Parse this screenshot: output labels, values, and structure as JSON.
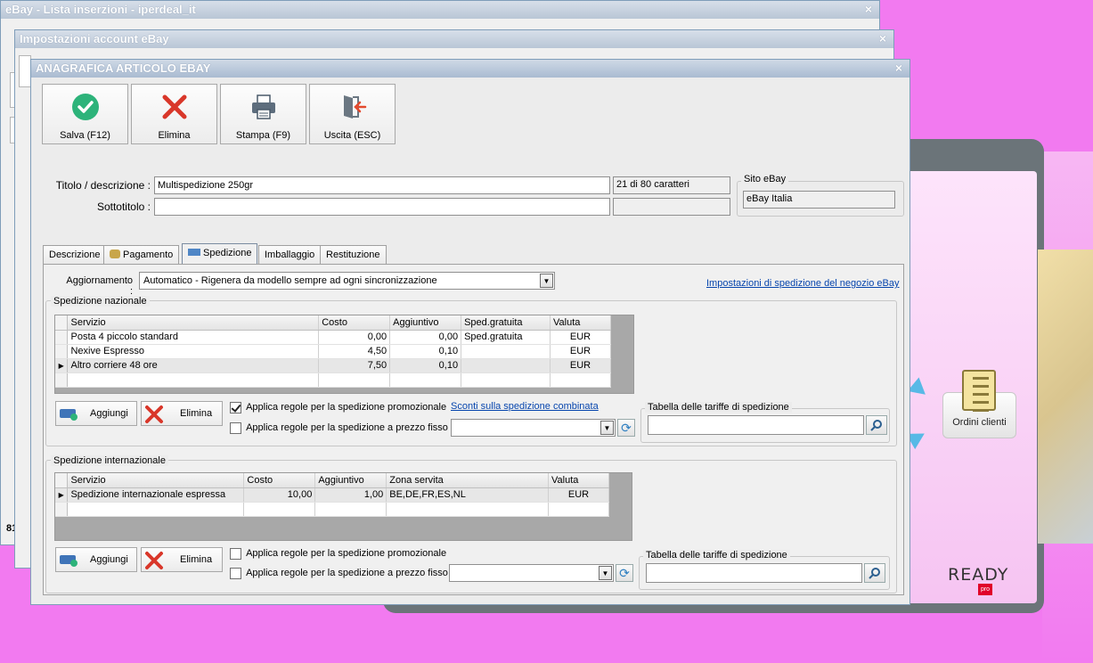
{
  "background": {
    "ordini_label": "Ordini clienti",
    "logo_text": "READY",
    "logo_badge": "pro"
  },
  "window_back1": {
    "title": "eBay - Lista inserzioni - iperdeal_it",
    "partial_statusbar": "81"
  },
  "window_back2": {
    "title": "Impostazioni account eBay"
  },
  "dialog": {
    "title": "ANAGRAFICA ARTICOLO EBAY",
    "close": "×",
    "toolbar": {
      "save": "Salva (F12)",
      "delete": "Elimina",
      "print": "Stampa (F9)",
      "exit": "Uscita (ESC)"
    },
    "titolo_label": "Titolo / descrizione :",
    "titolo_value": "Multispedizione 250gr",
    "titolo_counter": "21 di 80 caratteri",
    "sottotitolo_label": "Sottotitolo :",
    "sottotitolo_value": "",
    "sito_label": "Sito eBay",
    "sito_value": "eBay Italia",
    "tabs": [
      {
        "label": "Descrizione",
        "active": false
      },
      {
        "label": "Pagamento",
        "active": false
      },
      {
        "label": "Spedizione",
        "active": true
      },
      {
        "label": "Imballaggio",
        "active": false
      },
      {
        "label": "Restituzione",
        "active": false
      }
    ],
    "aggiornamento_label": "Aggiornamento :",
    "aggiornamento_value": "Automatico - Rigenera da modello sempre ad ogni sincronizzazione",
    "negozio_link": "Impostazioni di spedizione del negozio eBay",
    "nazionale": {
      "title": "Spedizione nazionale",
      "columns": [
        "Servizio",
        "Costo",
        "Aggiuntivo",
        "Sped.gratuita",
        "Valuta"
      ],
      "rows": [
        [
          "Posta 4 piccolo standard",
          "0,00",
          "0,00",
          "Sped.gratuita",
          "EUR"
        ],
        [
          "Nexive Espresso",
          "4,50",
          "0,10",
          "",
          "EUR"
        ],
        [
          "Altro corriere 48 ore",
          "7,50",
          "0,10",
          "",
          "EUR"
        ]
      ],
      "add_label": "Aggiungi",
      "delete_label": "Elimina",
      "promo_label": "Applica regole per la spedizione promozionale",
      "promo_checked": true,
      "fisso_label": "Applica regole per la spedizione a prezzo fisso",
      "fisso_checked": false,
      "sconti_link": "Sconti sulla spedizione combinata",
      "tariffe_label": "Tabella delle tariffe di spedizione"
    },
    "internazionale": {
      "title": "Spedizione internazionale",
      "columns": [
        "Servizio",
        "Costo",
        "Aggiuntivo",
        "Zona servita",
        "Valuta"
      ],
      "rows": [
        [
          "Spedizione internazionale espressa",
          "10,00",
          "1,00",
          "BE,DE,FR,ES,NL",
          "EUR"
        ]
      ],
      "add_label": "Aggiungi",
      "delete_label": "Elimina",
      "promo_label": "Applica regole per la spedizione promozionale",
      "promo_checked": false,
      "fisso_label": "Applica regole per la spedizione a prezzo fisso",
      "fisso_checked": false,
      "tariffe_label": "Tabella delle tariffe di spedizione"
    }
  }
}
